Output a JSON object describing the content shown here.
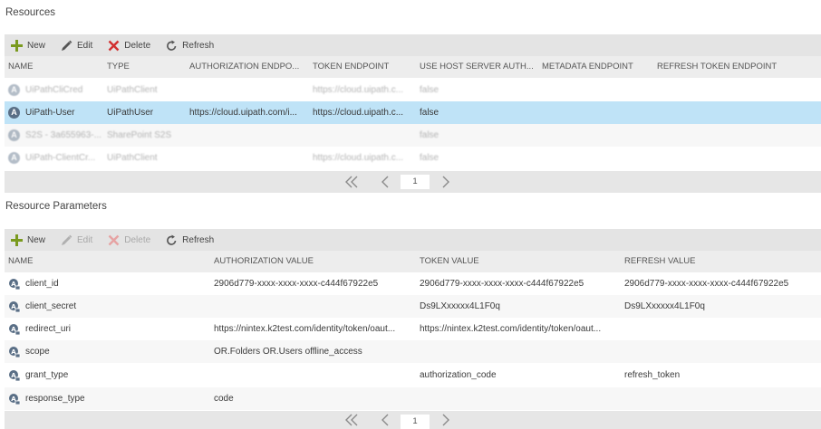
{
  "resources": {
    "title": "Resources",
    "toolbar": {
      "new": "New",
      "edit": "Edit",
      "delete": "Delete",
      "refresh": "Refresh"
    },
    "columns": [
      "NAME",
      "TYPE",
      "AUTHORIZATION ENDPO...",
      "TOKEN ENDPOINT",
      "USE HOST SERVER AUTH...",
      "METADATA ENDPOINT",
      "REFRESH TOKEN ENDPOINT"
    ],
    "rows": [
      {
        "icon": "A",
        "name": "UiPathCliCred",
        "type": "UiPathClient",
        "auth": "",
        "token": "https://cloud.uipath.c...",
        "use_host": "false",
        "metadata": "",
        "refresh": ""
      },
      {
        "icon": "A",
        "name": "UiPath-User",
        "type": "UiPathUser",
        "auth": "https://cloud.uipath.com/i...",
        "token": "https://cloud.uipath.c...",
        "use_host": "false",
        "metadata": "",
        "refresh": ""
      },
      {
        "icon": "A",
        "name": "S2S - 3a655963-...",
        "type": "SharePoint S2S",
        "auth": "",
        "token": "",
        "use_host": "false",
        "metadata": "",
        "refresh": ""
      },
      {
        "icon": "A",
        "name": "UiPath-ClientCr...",
        "type": "UiPathClient",
        "auth": "",
        "token": "https://cloud.uipath.c...",
        "use_host": "false",
        "metadata": "",
        "refresh": ""
      }
    ],
    "page": "1"
  },
  "parameters": {
    "title": "Resource Parameters",
    "toolbar": {
      "new": "New",
      "edit": "Edit",
      "delete": "Delete",
      "refresh": "Refresh"
    },
    "columns": [
      "NAME",
      "AUTHORIZATION VALUE",
      "TOKEN VALUE",
      "REFRESH VALUE"
    ],
    "rows": [
      {
        "name": "client_id",
        "auth": "2906d779-xxxx-xxxx-xxxx-c444f67922e5",
        "token": "2906d779-xxxx-xxxx-xxxx-c444f67922e5",
        "refresh": "2906d779-xxxx-xxxx-xxxx-c444f67922e5"
      },
      {
        "name": "client_secret",
        "auth": "",
        "token": "Ds9LXxxxxx4L1F0q",
        "refresh": "Ds9LXxxxxx4L1F0q"
      },
      {
        "name": "redirect_uri",
        "auth": "https://nintex.k2test.com/identity/token/oaut...",
        "token": "https://nintex.k2test.com/identity/token/oaut...",
        "refresh": ""
      },
      {
        "name": "scope",
        "auth": "OR.Folders OR.Users offline_access",
        "token": "",
        "refresh": ""
      },
      {
        "name": "grant_type",
        "auth": "",
        "token": "authorization_code",
        "refresh": "refresh_token"
      },
      {
        "name": "response_type",
        "auth": "code",
        "token": "",
        "refresh": ""
      }
    ],
    "page": "1"
  },
  "colors": {
    "toolbar_bg": "#e4e4e4",
    "selected_row": "#bfe3f7",
    "new_icon": "#7a9a1e",
    "delete_icon": "#d22f2f",
    "avatar": "#5a6f86"
  },
  "icons": {
    "new": "plus-icon",
    "edit": "pencil-icon",
    "delete": "x-icon",
    "refresh": "refresh-icon",
    "first": "double-chevron-left-icon",
    "prev": "chevron-left-icon",
    "next": "chevron-right-icon"
  }
}
